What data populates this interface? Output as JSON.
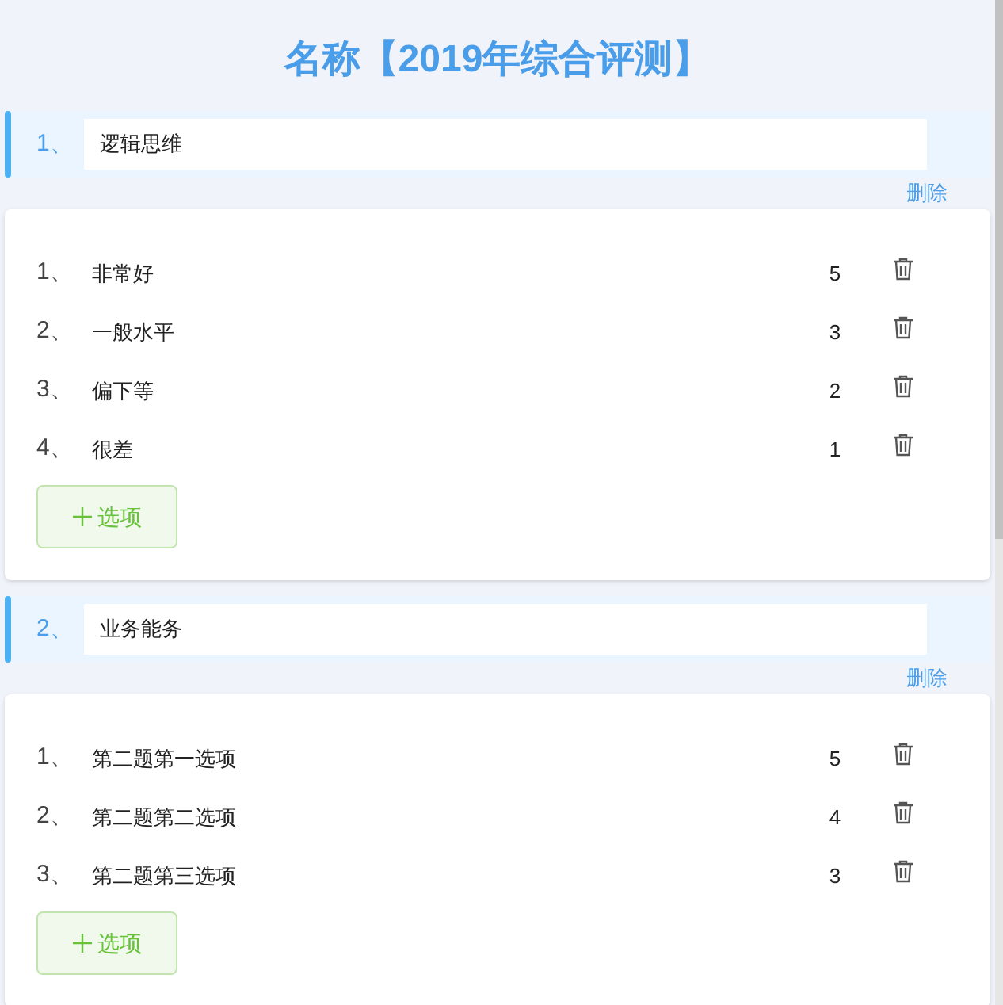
{
  "title": "名称【2019年综合评测】",
  "questions": [
    {
      "number": "1、",
      "name": "逻辑思维",
      "delete": "删除",
      "add_label": "选项",
      "options": [
        {
          "number": "1、",
          "text": "非常好",
          "score": "5"
        },
        {
          "number": "2、",
          "text": "一般水平",
          "score": "3"
        },
        {
          "number": "3、",
          "text": "偏下等",
          "score": "2"
        },
        {
          "number": "4、",
          "text": "很差",
          "score": "1"
        }
      ]
    },
    {
      "number": "2、",
      "name": "业务能务",
      "delete": "删除",
      "add_label": "选项",
      "options": [
        {
          "number": "1、",
          "text": "第二题第一选项",
          "score": "5"
        },
        {
          "number": "2、",
          "text": "第二题第二选项",
          "score": "4"
        },
        {
          "number": "3、",
          "text": "第二题第三选项",
          "score": "3"
        }
      ]
    }
  ]
}
